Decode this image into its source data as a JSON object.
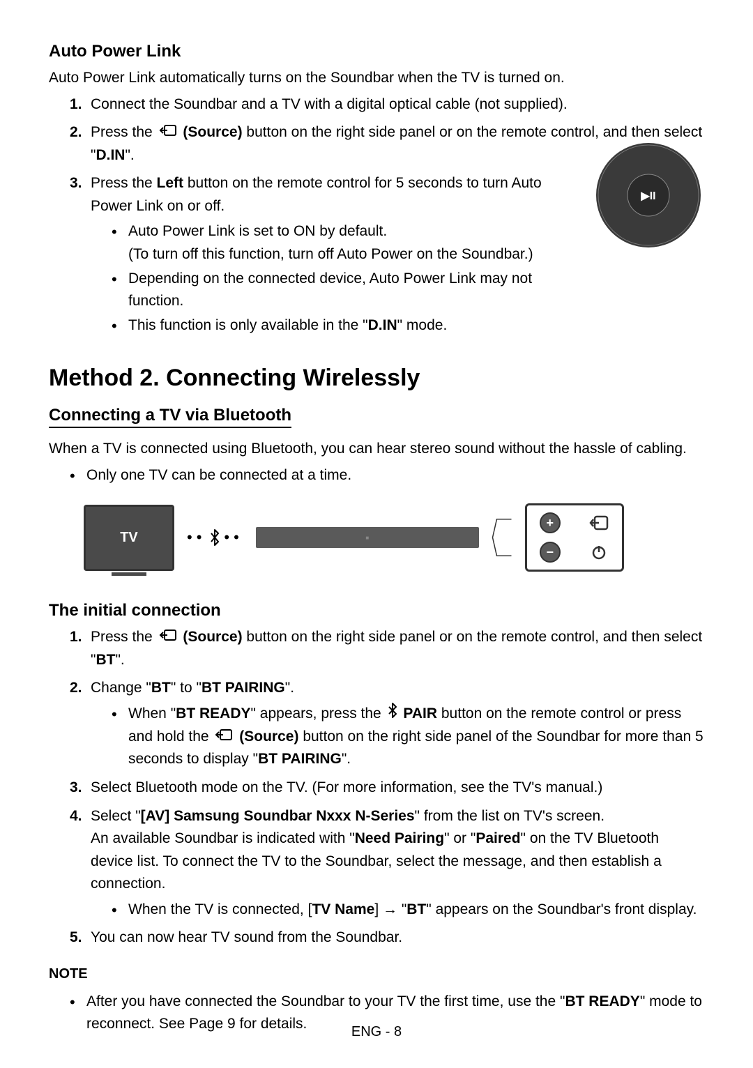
{
  "autoPowerLink": {
    "title": "Auto Power Link",
    "intro": "Auto Power Link automatically turns on the Soundbar when the TV is turned on.",
    "step1": "Connect the Soundbar and a TV with a digital optical cable (not supplied).",
    "step2_a": "Press the ",
    "step2_source": "(Source)",
    "step2_b": " button on the right side panel or on the remote control, and then select \"",
    "step2_din": "D.IN",
    "step2_c": "\".",
    "step3_a": "Press the ",
    "step3_left": "Left",
    "step3_b": " button on the remote control for 5 seconds to turn Auto Power Link on or off.",
    "bullet1_a": "Auto Power Link is set to ON by default.",
    "bullet1_b": "(To turn off this function, turn off Auto Power on the Soundbar.)",
    "bullet2": "Depending on the connected device, Auto Power Link may not function.",
    "bullet3_a": "This function is only available in the \"",
    "bullet3_din": "D.IN",
    "bullet3_b": "\" mode."
  },
  "method2": {
    "heading": "Method 2. Connecting Wirelessly",
    "subheading": "Connecting a TV via Bluetooth",
    "intro": "When a TV is connected using Bluetooth, you can hear stereo sound without the hassle of cabling.",
    "bullet": "Only one TV can be connected at a time."
  },
  "diagram": {
    "tvLabel": "TV"
  },
  "initialConnection": {
    "title": "The initial connection",
    "s1_a": "Press the ",
    "s1_source": "(Source)",
    "s1_b": " button on the right side panel or on the remote control, and then select \"",
    "s1_bt": "BT",
    "s1_c": "\".",
    "s2_a": "Change \"",
    "s2_bt": "BT",
    "s2_b": "\" to \"",
    "s2_btp": "BT PAIRING",
    "s2_c": "\".",
    "s2b_a": "When \"",
    "s2b_btready": "BT READY",
    "s2b_b": "\" appears, press the ",
    "s2b_pair": "PAIR",
    "s2b_c": " button on the remote control or press and hold the ",
    "s2b_source": "(Source)",
    "s2b_d": " button on the right side panel of the Soundbar for more than 5 seconds to display \"",
    "s2b_btp": "BT PAIRING",
    "s2b_e": "\".",
    "s3": "Select Bluetooth mode on the TV. (For more information, see the TV's manual.)",
    "s4_a": "Select \"",
    "s4_av": "[AV] Samsung Soundbar Nxxx N-Series",
    "s4_b": "\" from the list on TV's screen.",
    "s4_line2a": "An available Soundbar is indicated with \"",
    "s4_need": "Need Pairing",
    "s4_line2b": "\" or \"",
    "s4_paired": "Paired",
    "s4_line2c": "\" on the TV Bluetooth device list. To connect the TV to the Soundbar, select the message, and then establish a connection.",
    "s4b_a": "When the TV is connected, [",
    "s4b_tvname": "TV Name",
    "s4b_b": "] → \"",
    "s4b_bt": "BT",
    "s4b_c": "\" appears on the Soundbar's front display.",
    "s5": "You can now hear TV sound from the Soundbar."
  },
  "note": {
    "label": "NOTE",
    "text_a": "After you have connected the Soundbar to your TV the first time, use the \"",
    "text_btready": "BT READY",
    "text_b": "\" mode to reconnect. See Page 9 for details."
  },
  "footer": "ENG - 8"
}
